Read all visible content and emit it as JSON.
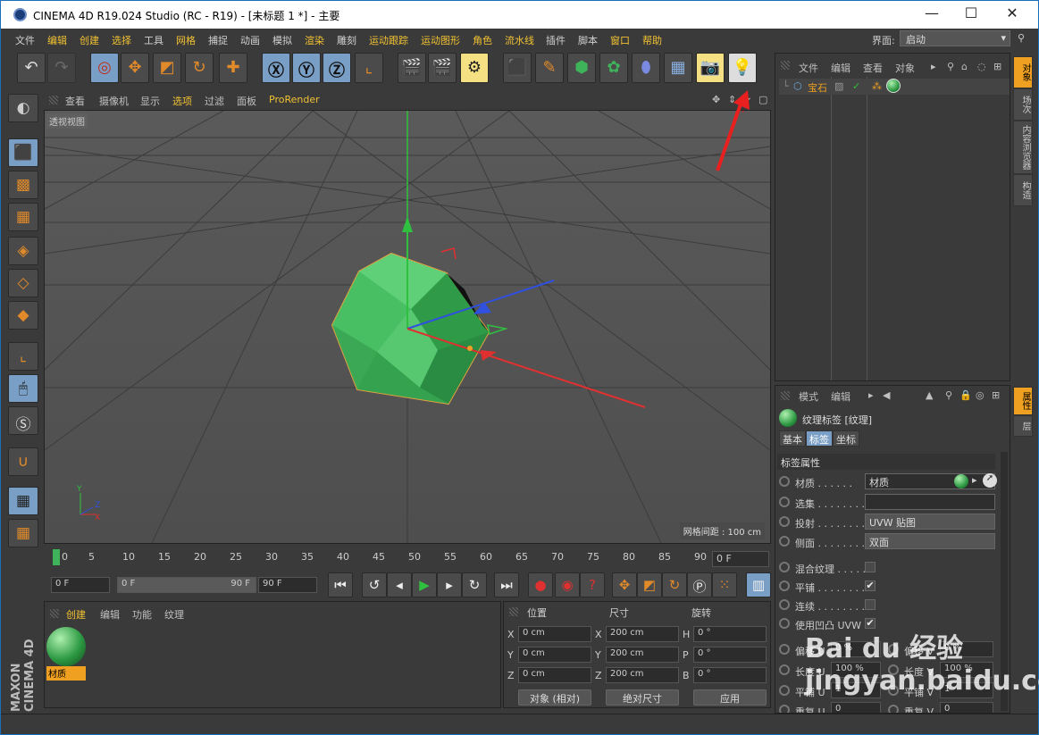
{
  "title": "CINEMA 4D R19.024 Studio (RC - R19) - [未标题 1 *] - 主要",
  "window_controls": [
    "—",
    "☐",
    "✕"
  ],
  "menu": [
    "文件",
    "编辑",
    "创建",
    "选择",
    "工具",
    "网格",
    "捕捉",
    "动画",
    "模拟",
    "渲染",
    "雕刻",
    "运动跟踪",
    "运动图形",
    "角色",
    "流水线",
    "插件",
    "脚本",
    "窗口",
    "帮助"
  ],
  "layout": {
    "label": "界面:",
    "value": "启动"
  },
  "viewport": {
    "menu": [
      "查看",
      "摄像机",
      "显示",
      "选项",
      "过滤",
      "面板",
      "ProRender"
    ],
    "label": "透视视图",
    "grid_spacing": "网格间距 : 100 cm"
  },
  "timeline": {
    "ticks": [
      "0",
      "5",
      "10",
      "15",
      "20",
      "25",
      "30",
      "35",
      "40",
      "45",
      "50",
      "55",
      "60",
      "65",
      "70",
      "75",
      "80",
      "85",
      "90"
    ],
    "current_frame": "0 F",
    "start": "0 F",
    "range_start": "0 F",
    "range_end": "90 F",
    "end": "90 F"
  },
  "material_panel": {
    "menu": [
      "创建",
      "编辑",
      "功能",
      "纹理"
    ],
    "material_name": "材质"
  },
  "coords": {
    "headers": [
      "位置",
      "尺寸",
      "旋转"
    ],
    "pos": {
      "x": "0 cm",
      "y": "0 cm",
      "z": "0 cm"
    },
    "size": {
      "x": "200 cm",
      "y": "200 cm",
      "z": "200 cm"
    },
    "rot": {
      "h": "0 °",
      "p": "0 °",
      "b": "0 °"
    },
    "axis_labels": [
      "X",
      "Y",
      "Z",
      "X",
      "Y",
      "Z",
      "H",
      "P",
      "B"
    ],
    "mode": "对象 (相对)",
    "size_mode": "绝对尺寸",
    "apply": "应用"
  },
  "object_manager": {
    "menu": [
      "文件",
      "编辑",
      "查看",
      "对象"
    ],
    "object_name": "宝石"
  },
  "attributes": {
    "menu": [
      "模式",
      "编辑"
    ],
    "title": "纹理标签 [纹理]",
    "tabs": [
      "基本",
      "标签",
      "坐标"
    ],
    "section": "标签属性",
    "rows": [
      {
        "label": "材质 . . . . . .",
        "value": "材质"
      },
      {
        "label": "选集 . . . . . . . .",
        "value": ""
      },
      {
        "label": "投射 . . . . . . . .",
        "value": "UVW 贴图"
      },
      {
        "label": "侧面 . . . . . . . .",
        "value": "双面"
      }
    ],
    "checks": [
      {
        "label": "混合纹理 . . . . .",
        "checked": ""
      },
      {
        "label": "平铺 . . . . . . . .",
        "checked": "✔"
      },
      {
        "label": "连续 . . . . . . . .",
        "checked": ""
      },
      {
        "label": "使用凹凸 UVW",
        "checked": "✔"
      }
    ],
    "offset": {
      "u_label": "偏移 U",
      "u": "0 %",
      "v_label": "偏移 V",
      "v": "0 %"
    },
    "length": {
      "u_label": "长度 U",
      "u": "100 %",
      "v_label": "长度 V",
      "v": "100 %"
    },
    "tile": {
      "u_label": "平铺 U",
      "u": "1",
      "v_label": "平铺 V",
      "v": "1"
    },
    "repeat": {
      "u_label": "重复 U",
      "u": "0",
      "v_label": "重复 V",
      "v": "0"
    }
  },
  "right_tabs_top": [
    "对象",
    "场次",
    "内容浏览器",
    "构造"
  ],
  "right_tabs_bottom": [
    "属性",
    "层"
  ],
  "brand": "MAXON CINEMA 4D",
  "watermark": "Bai du 经验 jingyan.baidu.com",
  "colors": {
    "accent": "#f0a020",
    "select_blue": "#7a9fc6",
    "model_green": "#3fb35a",
    "axis_x": "#e03030",
    "axis_y": "#30c040",
    "axis_z": "#3050e0"
  }
}
